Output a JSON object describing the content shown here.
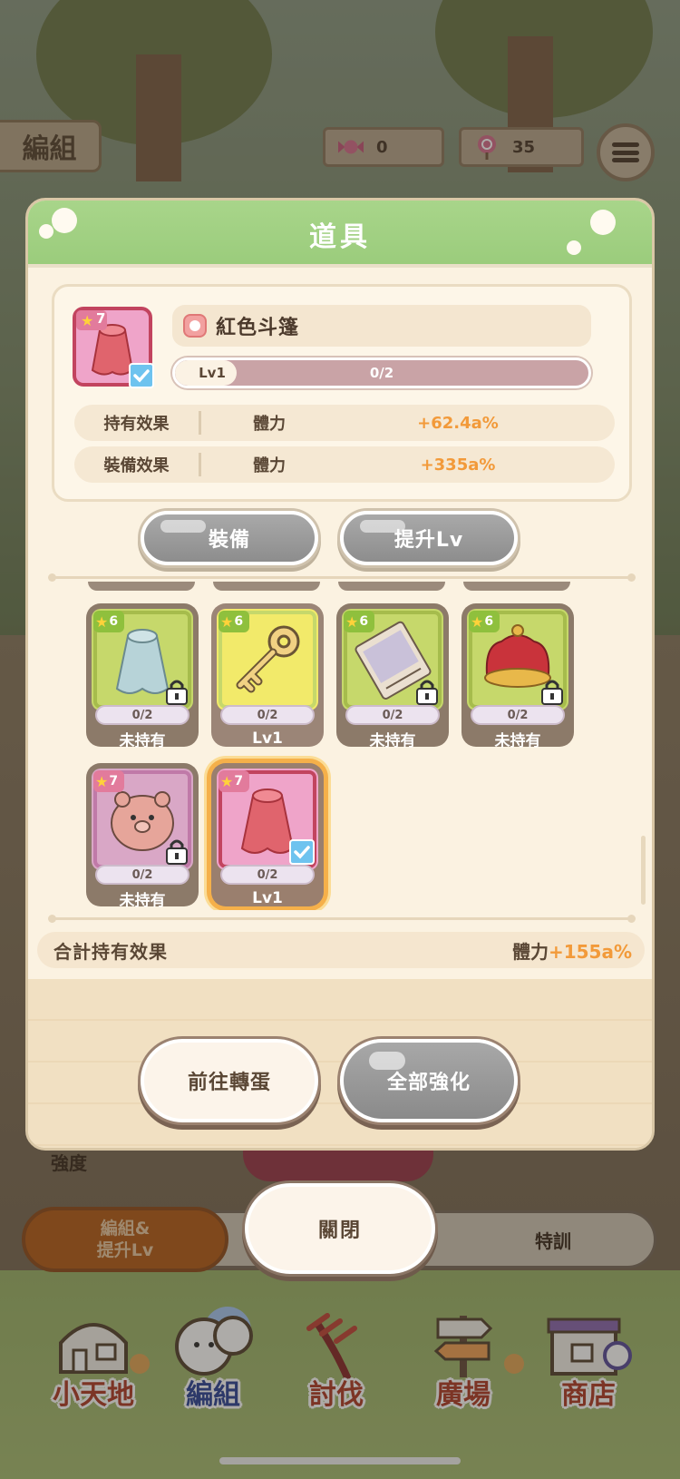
{
  "top_bar": {
    "section_tab": "編組",
    "candy": {
      "icon": "candy-icon",
      "value": "0"
    },
    "lollipop": {
      "icon": "lollipop-icon",
      "value": "35"
    },
    "menu_icon": "list-menu-icon"
  },
  "modal": {
    "title": "道具",
    "item": {
      "name": "紅色斗篷",
      "rarity": "7",
      "level_label": "Lv1",
      "progress_text": "0/2",
      "progress_fraction": 0.15,
      "effects": [
        {
          "label": "持有效果",
          "stat": "體力",
          "value": "+62.4a%"
        },
        {
          "label": "裝備效果",
          "stat": "體力",
          "value": "+335a%"
        }
      ]
    },
    "buttons": {
      "equip": "裝備",
      "level_up": "提升Lv"
    },
    "items": [
      {
        "name": "blue-cloak",
        "rarity": "6",
        "count": "0/2",
        "status": "未持有",
        "locked": true,
        "selected": false,
        "bg": "#c6d86b"
      },
      {
        "name": "key",
        "rarity": "6",
        "count": "0/2",
        "status": "Lv1",
        "locked": false,
        "selected": false,
        "bg": "#f2ea6a"
      },
      {
        "name": "photo-card",
        "rarity": "6",
        "count": "0/2",
        "status": "未持有",
        "locked": true,
        "selected": false,
        "bg": "#c6d86b"
      },
      {
        "name": "crown",
        "rarity": "6",
        "count": "0/2",
        "status": "未持有",
        "locked": true,
        "selected": false,
        "bg": "#c6d86b"
      },
      {
        "name": "bear-plush",
        "rarity": "7",
        "count": "0/2",
        "status": "未持有",
        "locked": true,
        "selected": false,
        "bg": "#d9a7c6"
      },
      {
        "name": "red-cloak",
        "rarity": "7",
        "count": "0/2",
        "status": "Lv1",
        "locked": false,
        "selected": true,
        "bg": "#efa4c9"
      }
    ],
    "total": {
      "label": "合計持有效果",
      "stat": "體力",
      "value": "+155a%"
    },
    "bottom_buttons": {
      "gacha": "前往轉蛋",
      "enhance_all": "全部強化"
    }
  },
  "behind": {
    "strength_label": "強度",
    "tabs": {
      "formation_levelup": "編組&\n提升Lv",
      "training": "特訓"
    },
    "close": "關閉"
  },
  "nav": [
    {
      "label": "小天地",
      "icon": "house-icon",
      "active": false
    },
    {
      "label": "編組",
      "icon": "characters-icon",
      "active": true
    },
    {
      "label": "討伐",
      "icon": "weapon-icon",
      "active": false
    },
    {
      "label": "廣場",
      "icon": "signpost-icon",
      "active": false
    },
    {
      "label": "商店",
      "icon": "shop-icon",
      "active": false
    }
  ],
  "colors": {
    "header_green": "#a8d58a",
    "accent_orange": "#f29a3a",
    "button_gray": "#9a9a9a",
    "selected_outline": "#f5b04a",
    "nav_red": "#b0402d",
    "nav_active_blue": "#31479a"
  }
}
